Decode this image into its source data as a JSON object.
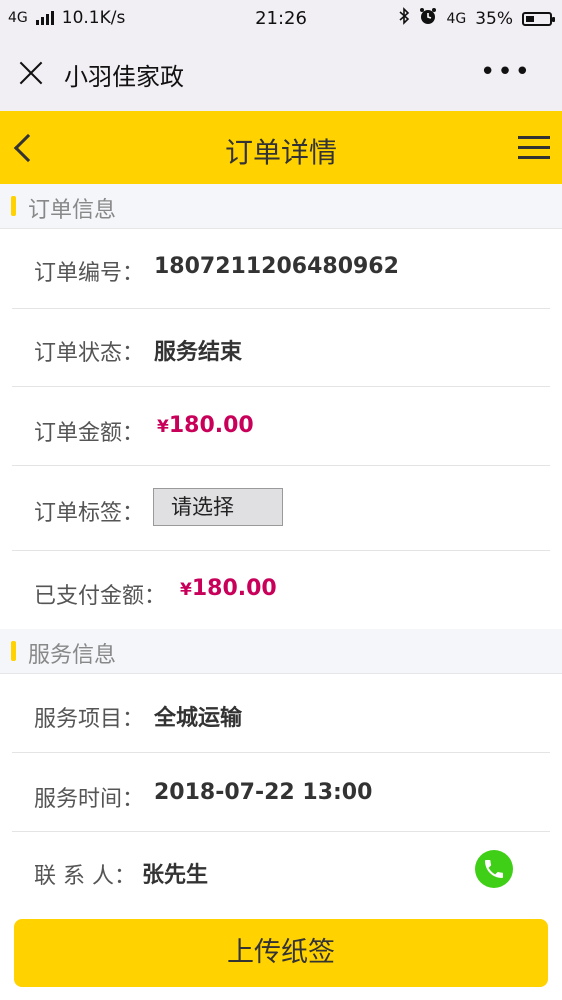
{
  "status_bar": {
    "network": "4G",
    "speed": "10.1K/s",
    "time": "21:26",
    "network_right": "4G",
    "battery": "35%",
    "battery_level": 0.35
  },
  "wechat_bar": {
    "title": "小羽佳家政",
    "more": "•••"
  },
  "header": {
    "title": "订单详情"
  },
  "order_section": {
    "title": "订单信息",
    "rows": [
      {
        "label": "订单编号：",
        "value": "1807211206480962"
      },
      {
        "label": "订单状态：",
        "value": "服务结束"
      },
      {
        "label": "订单金额：",
        "currency": "¥",
        "value": "180.00"
      },
      {
        "label": "订单标签：",
        "select": "请选择"
      },
      {
        "label": "已支付金额：",
        "currency": "¥",
        "value": "180.00"
      }
    ]
  },
  "service_section": {
    "title": "服务信息",
    "rows": [
      {
        "label": "服务项目：",
        "value": "全城运输"
      },
      {
        "label": "服务时间：",
        "value": "2018-07-22 13:00"
      },
      {
        "label": "联 系 人：",
        "value": "张先生"
      }
    ]
  },
  "bottom": {
    "button_label": "上传纸签"
  },
  "colors": {
    "accent": "#ffd200",
    "price": "#c8005a",
    "phone": "#3fcf17"
  }
}
